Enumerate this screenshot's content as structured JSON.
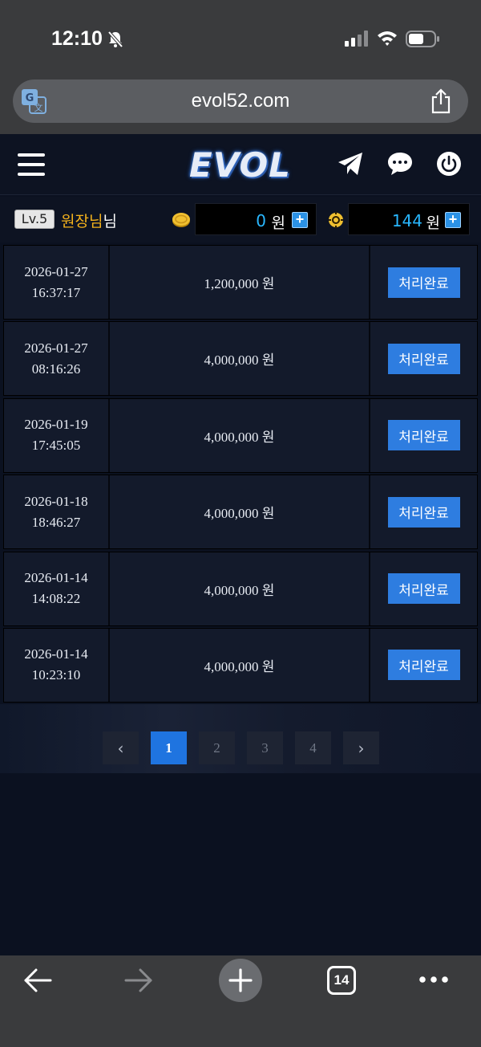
{
  "status_bar": {
    "time": "12:10"
  },
  "browser": {
    "url": "evol52.com",
    "tab_count": "14"
  },
  "site": {
    "logo": "EVOL",
    "user": {
      "level": "Lv.5",
      "name": "원장님",
      "suffix": "님"
    },
    "balances": [
      {
        "value": "0",
        "unit": "원"
      },
      {
        "value": "144",
        "unit": "원"
      }
    ],
    "rows": [
      {
        "date": "2026-01-27",
        "time": "16:37:17",
        "amount": "1,200,000 원",
        "status": "처리완료"
      },
      {
        "date": "2026-01-27",
        "time": "08:16:26",
        "amount": "4,000,000 원",
        "status": "처리완료"
      },
      {
        "date": "2026-01-19",
        "time": "17:45:05",
        "amount": "4,000,000 원",
        "status": "처리완료"
      },
      {
        "date": "2026-01-18",
        "time": "18:46:27",
        "amount": "4,000,000 원",
        "status": "처리완료"
      },
      {
        "date": "2026-01-14",
        "time": "14:08:22",
        "amount": "4,000,000 원",
        "status": "처리완료"
      },
      {
        "date": "2026-01-14",
        "time": "10:23:10",
        "amount": "4,000,000 원",
        "status": "처리완료"
      }
    ],
    "pagination": {
      "prev": "‹",
      "pages": [
        "1",
        "2",
        "3",
        "4"
      ],
      "next": "›",
      "active": "1"
    }
  },
  "colors": {
    "accent": "#2e7de0",
    "balance": "#29b7ff",
    "username": "#f4b21c"
  }
}
